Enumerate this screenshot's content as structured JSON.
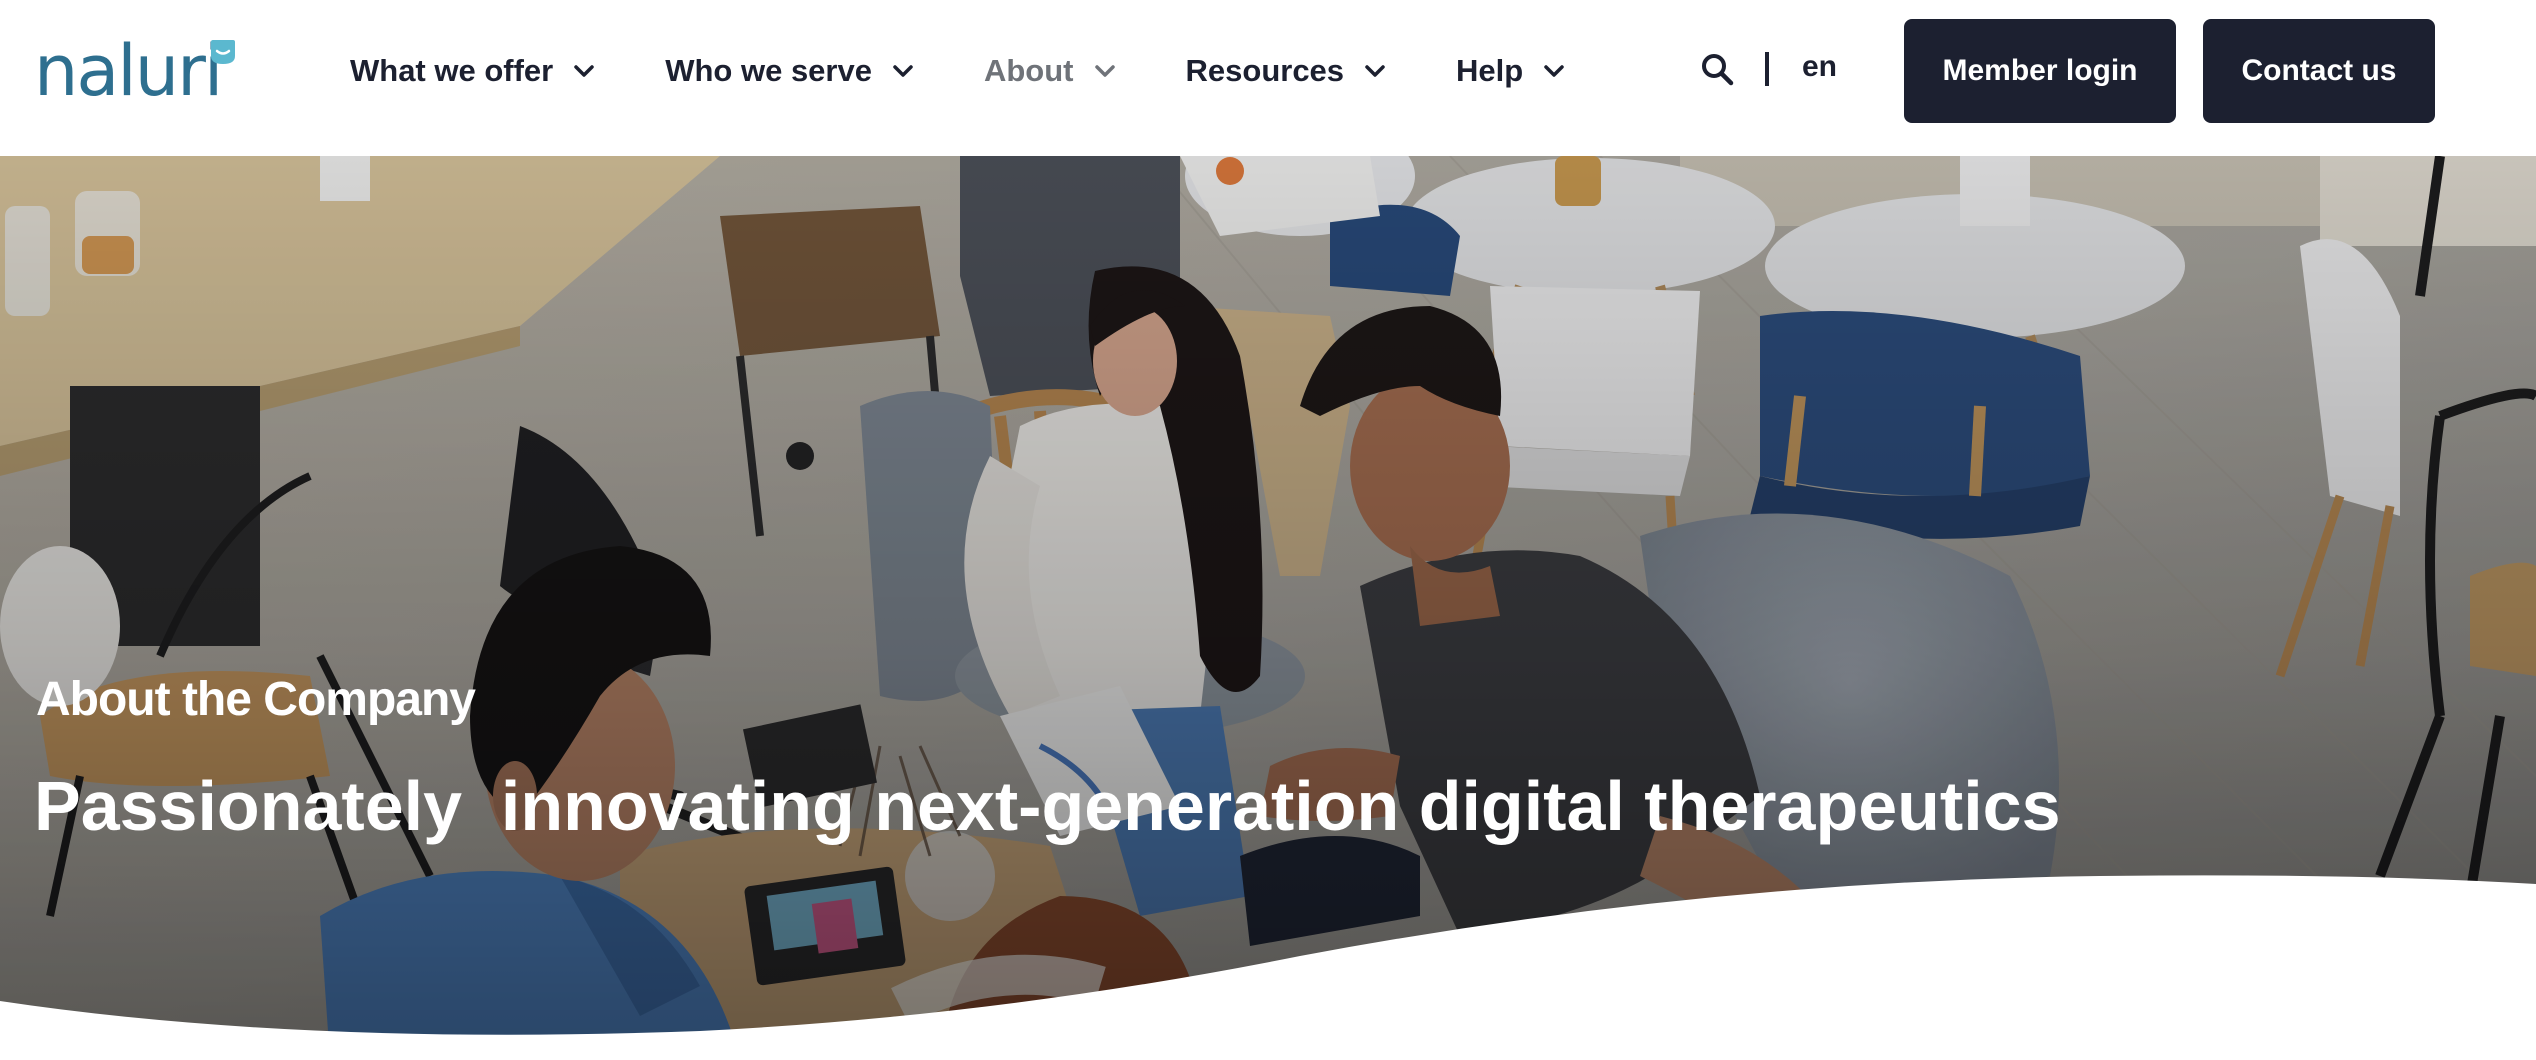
{
  "brand": {
    "name": "naluri"
  },
  "nav": {
    "items": [
      {
        "label": "What we offer",
        "active": false
      },
      {
        "label": "Who we serve",
        "active": false
      },
      {
        "label": "About",
        "active": true
      },
      {
        "label": "Resources",
        "active": false
      },
      {
        "label": "Help",
        "active": false
      }
    ]
  },
  "header": {
    "search_icon": "search-icon",
    "language": "en",
    "member_login": "Member login",
    "contact_us": "Contact us"
  },
  "hero": {
    "eyebrow": "About the Company",
    "title": "Passionately  innovating next-generation digital therapeutics"
  },
  "colors": {
    "brand_teal": "#2e6f8f",
    "badge_teal": "#5bb8cf",
    "button_dark": "#1c2030",
    "nav_active": "#6f7379"
  }
}
